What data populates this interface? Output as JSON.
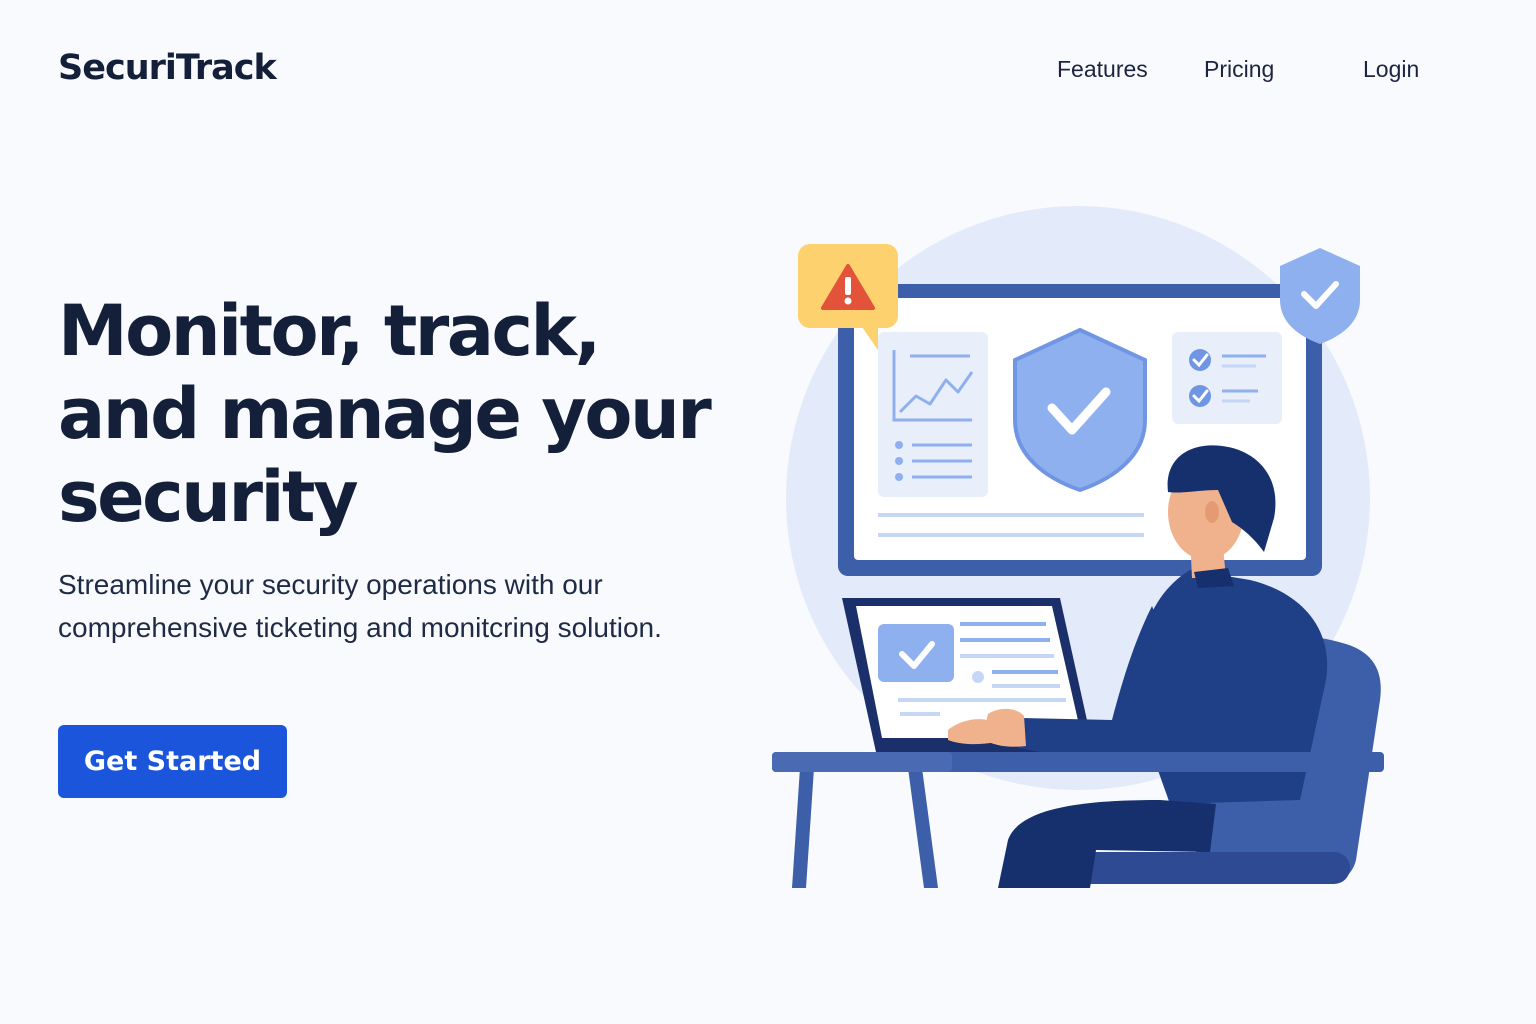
{
  "header": {
    "brand": "SecuriTrack",
    "nav": [
      {
        "label": "Features"
      },
      {
        "label": "Pricing"
      },
      {
        "label": "Login"
      }
    ]
  },
  "hero": {
    "title": "Monitor, track, and manage your security",
    "subtitle": "Streamline your security operations with our comprehensive ticketing and monitcring solution.",
    "cta_label": "Get Started"
  },
  "illustration": {
    "icons": [
      "warning-icon",
      "shield-check-icon",
      "line-chart-icon",
      "checklist-icon",
      "person-at-laptop"
    ]
  },
  "colors": {
    "accent": "#1a55dc",
    "heading": "#14203a",
    "illustration_dark": "#1b2f6b",
    "illustration_mid": "#3d5ea8",
    "illustration_light": "#8fb0ef",
    "illustration_bg": "#e3ebfa",
    "warning_bubble": "#fdd16e",
    "warning_triangle": "#e2533a"
  }
}
